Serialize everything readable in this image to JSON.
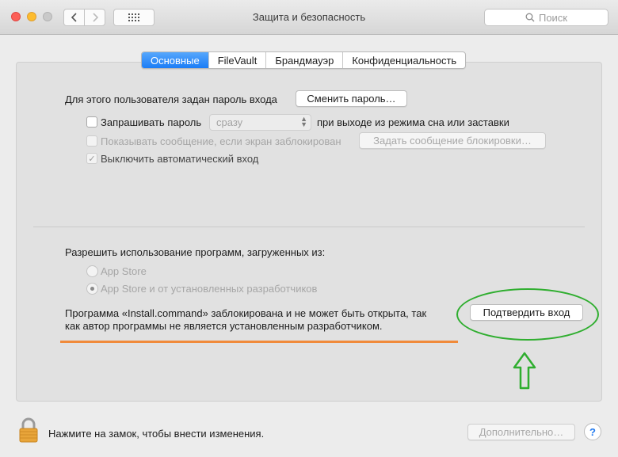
{
  "window": {
    "title": "Защита и безопасность",
    "search_placeholder": "Поиск"
  },
  "tabs": [
    {
      "label": "Основные",
      "active": true
    },
    {
      "label": "FileVault",
      "active": false
    },
    {
      "label": "Брандмауэр",
      "active": false
    },
    {
      "label": "Конфиденциальность",
      "active": false
    }
  ],
  "password": {
    "label": "Для этого пользователя задан пароль входа",
    "change_button": "Сменить пароль…",
    "require_label": "Запрашивать пароль",
    "require_checked": false,
    "delay_value": "сразу",
    "after_label": "при выходе из режима сна или заставки",
    "show_message_label": "Показывать сообщение, если экран заблокирован",
    "show_message_checked": false,
    "set_message_button": "Задать сообщение блокировки…",
    "disable_autologin_label": "Выключить автоматический вход",
    "disable_autologin_checked": true
  },
  "apps": {
    "label": "Разрешить использование программ, загруженных из:",
    "options": [
      {
        "label": "App Store",
        "selected": false
      },
      {
        "label": "App Store и от установленных разработчиков",
        "selected": true
      }
    ],
    "blocked_line1": "Программа «Install.command» заблокирована и не может быть открыта, так",
    "blocked_line2": "как автор программы не является установленным разработчиком.",
    "confirm_button": "Подтвердить вход"
  },
  "footer": {
    "lock_text": "Нажмите на замок, чтобы внести изменения.",
    "advanced_button": "Дополнительно…",
    "help_label": "?"
  },
  "colors": {
    "accent": "#1a7cf6",
    "highlight_underline": "#f08a3a",
    "annotation_green": "#2fae2f",
    "lock_gold": "#e8a53a"
  },
  "icons": {
    "back": "chevron-left-icon",
    "forward": "chevron-right-icon",
    "grid": "grid-icon",
    "search": "search-icon",
    "lock": "lock-icon",
    "help": "question-mark-icon"
  }
}
